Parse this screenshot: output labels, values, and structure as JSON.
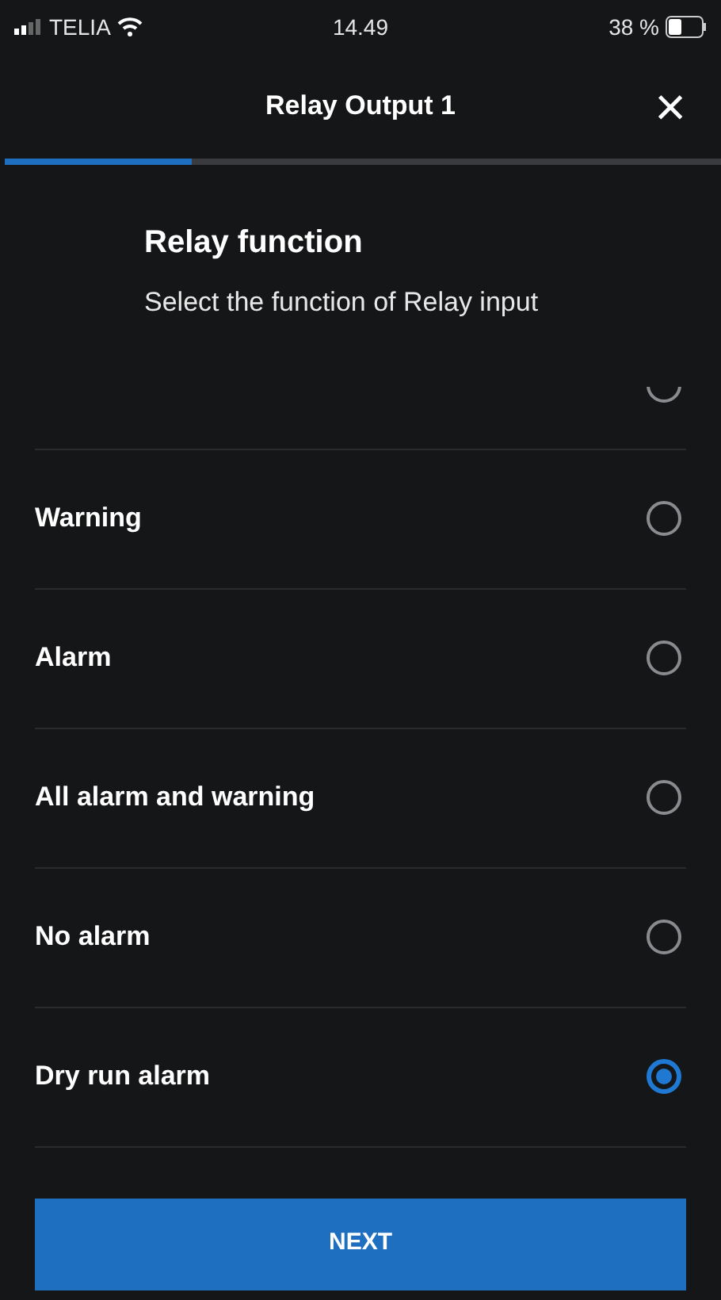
{
  "status_bar": {
    "carrier": "TELIA",
    "time": "14.49",
    "battery": "38 %"
  },
  "header": {
    "title": "Relay Output 1",
    "close": "×"
  },
  "progress": {
    "level": 0.26
  },
  "section": {
    "title": "Relay function",
    "subtitle": "Select the function of Relay input"
  },
  "options": [
    {
      "selected": false
    },
    {
      "label": "Warning",
      "selected": false
    },
    {
      "label": "Alarm",
      "selected": false
    },
    {
      "label": "All alarm and warning",
      "selected": false
    },
    {
      "label": "No alarm",
      "selected": false
    },
    {
      "label": "Dry run alarm",
      "selected": true
    }
  ],
  "button": "NEXT"
}
